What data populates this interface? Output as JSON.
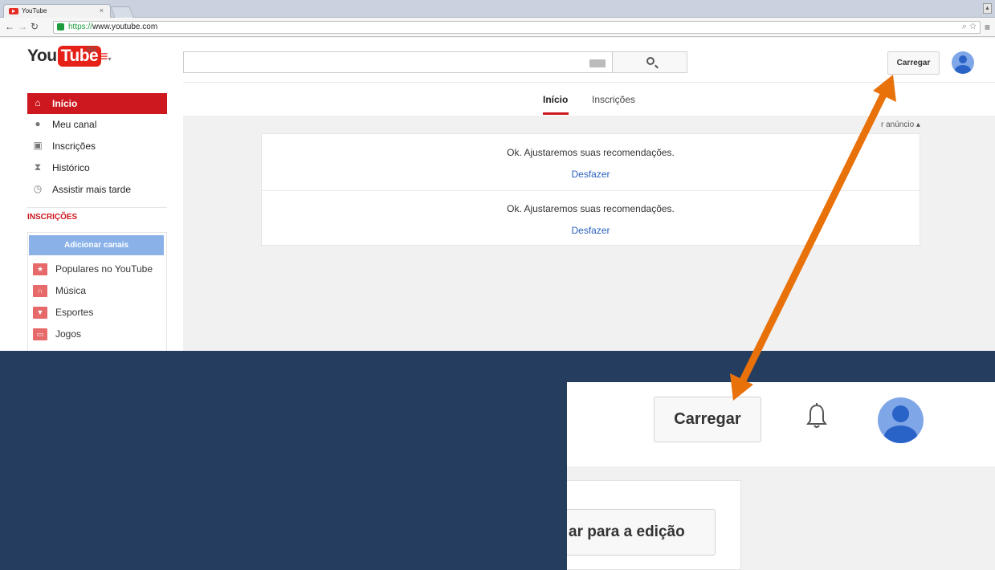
{
  "browser": {
    "tab_title": "YouTube",
    "tab_close": "×",
    "url_scheme": "https://",
    "url_rest": "www.youtube.com"
  },
  "header": {
    "logo_you": "You",
    "logo_tube": "Tube",
    "logo_country": "BR",
    "upload_label": "Carregar"
  },
  "sidebar": {
    "items": [
      {
        "label": "Início",
        "icon": "home-icon"
      },
      {
        "label": "Meu canal",
        "icon": "person-icon"
      },
      {
        "label": "Inscrições",
        "icon": "subscriptions-icon"
      },
      {
        "label": "Histórico",
        "icon": "hourglass-icon"
      },
      {
        "label": "Assistir mais tarde",
        "icon": "clock-icon"
      }
    ],
    "section_title": "INSCRIÇÕES",
    "add_channels": "Adicionar canais",
    "subscriptions": [
      {
        "label": "Populares no YouTube",
        "icon": "star-icon"
      },
      {
        "label": "Música",
        "icon": "headphones-icon"
      },
      {
        "label": "Esportes",
        "icon": "trophy-icon"
      },
      {
        "label": "Jogos",
        "icon": "gamepad-icon"
      }
    ]
  },
  "feed": {
    "tabs": [
      "Início",
      "Inscrições"
    ],
    "ad_text": "r anúncio ▴",
    "rows": [
      {
        "message": "Ok. Ajustaremos suas recomendações.",
        "undo": "Desfazer"
      },
      {
        "message": "Ok. Ajustaremos suas recomendações.",
        "undo": "Desfazer"
      }
    ]
  },
  "zoom": {
    "upload_label": "Carregar",
    "edit_button": "ar para a edição"
  },
  "colors": {
    "background": "#253d5e",
    "arrow": "#e8710a",
    "youtube_red": "#cc181e",
    "link_blue": "#2a62bf"
  }
}
